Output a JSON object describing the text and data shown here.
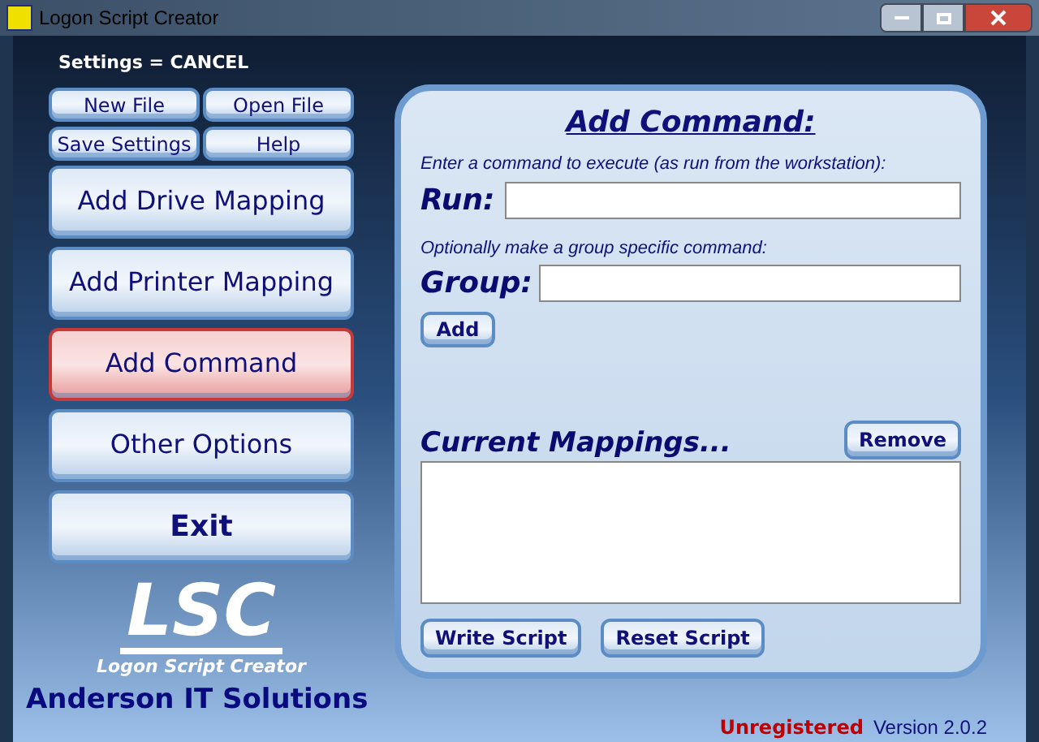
{
  "window": {
    "title": "Logon Script Creator"
  },
  "settings_status": "Settings = CANCEL",
  "file_buttons": [
    "New File",
    "Open File",
    "Save Settings",
    "Help"
  ],
  "nav": [
    {
      "label": "Add Drive Mapping",
      "selected": false
    },
    {
      "label": "Add Printer Mapping",
      "selected": false
    },
    {
      "label": "Add Command",
      "selected": true
    },
    {
      "label": "Other Options",
      "selected": false
    },
    {
      "label": "Exit",
      "selected": false
    }
  ],
  "logo": {
    "mark": "LSC",
    "subtitle": "Logon Script Creator"
  },
  "company": "Anderson IT Solutions",
  "panel": {
    "title": "Add Command:",
    "run_hint": "Enter a command to execute (as run from the workstation):",
    "run_label": "Run:",
    "group_hint": "Optionally make a group specific command:",
    "group_label": "Group:",
    "add_button": "Add",
    "mappings_title": "Current Mappings...",
    "remove_button": "Remove",
    "actions": [
      "Write Script",
      "Reset Script"
    ]
  },
  "status": {
    "registration": "Unregistered",
    "version": "Version 2.0.2"
  }
}
